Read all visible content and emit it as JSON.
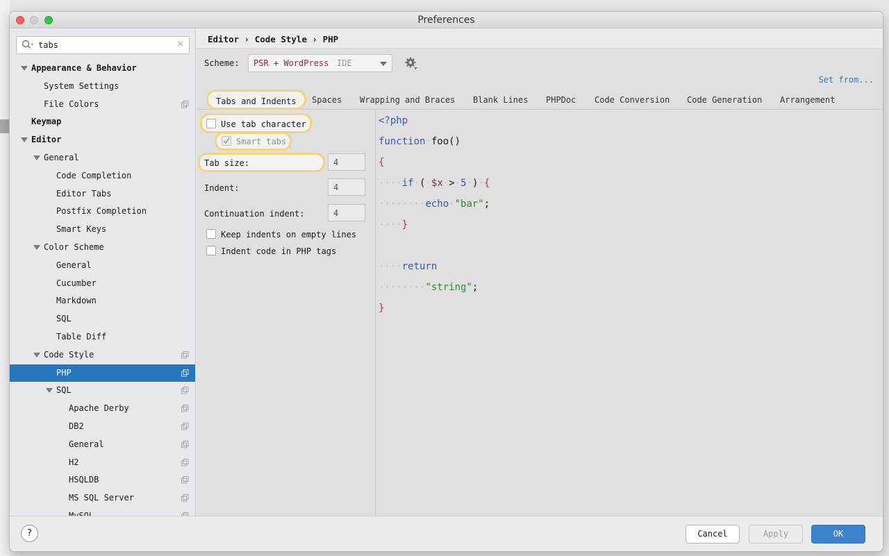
{
  "window": {
    "title": "Preferences"
  },
  "search": {
    "query": "tabs",
    "clear_icon": "×"
  },
  "tree": [
    {
      "label": "Appearance & Behavior",
      "level": 0,
      "bold": true,
      "expanded": true,
      "copy": false,
      "selected": false
    },
    {
      "label": "System Settings",
      "level": 1,
      "bold": false,
      "expanded": false,
      "copy": false,
      "selected": false
    },
    {
      "label": "File Colors",
      "level": 1,
      "bold": false,
      "expanded": false,
      "copy": true,
      "selected": false
    },
    {
      "label": "Keymap",
      "level": 0,
      "bold": true,
      "expanded": false,
      "copy": false,
      "selected": false
    },
    {
      "label": "Editor",
      "level": 0,
      "bold": true,
      "expanded": true,
      "copy": false,
      "selected": false
    },
    {
      "label": "General",
      "level": 1,
      "bold": false,
      "expanded": true,
      "copy": false,
      "selected": false
    },
    {
      "label": "Code Completion",
      "level": 2,
      "bold": false,
      "expanded": false,
      "copy": false,
      "selected": false
    },
    {
      "label": "Editor Tabs",
      "level": 2,
      "bold": false,
      "expanded": false,
      "copy": false,
      "selected": false
    },
    {
      "label": "Postfix Completion",
      "level": 2,
      "bold": false,
      "expanded": false,
      "copy": false,
      "selected": false
    },
    {
      "label": "Smart Keys",
      "level": 2,
      "bold": false,
      "expanded": false,
      "copy": false,
      "selected": false
    },
    {
      "label": "Color Scheme",
      "level": 1,
      "bold": false,
      "expanded": true,
      "copy": false,
      "selected": false
    },
    {
      "label": "General",
      "level": 2,
      "bold": false,
      "expanded": false,
      "copy": false,
      "selected": false
    },
    {
      "label": "Cucumber",
      "level": 2,
      "bold": false,
      "expanded": false,
      "copy": false,
      "selected": false
    },
    {
      "label": "Markdown",
      "level": 2,
      "bold": false,
      "expanded": false,
      "copy": false,
      "selected": false
    },
    {
      "label": "SQL",
      "level": 2,
      "bold": false,
      "expanded": false,
      "copy": false,
      "selected": false
    },
    {
      "label": "Table Diff",
      "level": 2,
      "bold": false,
      "expanded": false,
      "copy": false,
      "selected": false
    },
    {
      "label": "Code Style",
      "level": 1,
      "bold": false,
      "expanded": true,
      "copy": true,
      "selected": false
    },
    {
      "label": "PHP",
      "level": 2,
      "bold": false,
      "expanded": false,
      "copy": true,
      "selected": true
    },
    {
      "label": "SQL",
      "level": 2,
      "bold": false,
      "expanded": true,
      "copy": true,
      "selected": false
    },
    {
      "label": "Apache Derby",
      "level": 3,
      "bold": false,
      "expanded": false,
      "copy": true,
      "selected": false
    },
    {
      "label": "DB2",
      "level": 3,
      "bold": false,
      "expanded": false,
      "copy": true,
      "selected": false
    },
    {
      "label": "General",
      "level": 3,
      "bold": false,
      "expanded": false,
      "copy": true,
      "selected": false
    },
    {
      "label": "H2",
      "level": 3,
      "bold": false,
      "expanded": false,
      "copy": true,
      "selected": false
    },
    {
      "label": "HSQLDB",
      "level": 3,
      "bold": false,
      "expanded": false,
      "copy": true,
      "selected": false
    },
    {
      "label": "MS SQL Server",
      "level": 3,
      "bold": false,
      "expanded": false,
      "copy": true,
      "selected": false
    },
    {
      "label": "MySQL",
      "level": 3,
      "bold": false,
      "expanded": false,
      "copy": true,
      "selected": false
    }
  ],
  "breadcrumb": "Editor › Code Style › PHP",
  "scheme": {
    "label": "Scheme:",
    "value": "PSR + WordPress",
    "tag": "IDE",
    "set_from": "Set from..."
  },
  "tabs": [
    "Tabs and Indents",
    "Spaces",
    "Wrapping and Braces",
    "Blank Lines",
    "PHPDoc",
    "Code Conversion",
    "Code Generation",
    "Arrangement"
  ],
  "active_tab": "Tabs and Indents",
  "options": {
    "use_tab": {
      "label": "Use tab character",
      "checked": false
    },
    "smart_tabs": {
      "label": "Smart tabs",
      "checked": true,
      "enabled": false
    },
    "tab_size": {
      "label": "Tab size:",
      "value": "4"
    },
    "indent": {
      "label": "Indent:",
      "value": "4"
    },
    "continuation": {
      "label": "Continuation indent:",
      "value": "4"
    },
    "keep_indents": {
      "label": "Keep indents on empty lines",
      "checked": false
    },
    "indent_php_tags": {
      "label": "Indent code in PHP tags",
      "checked": false
    }
  },
  "code": {
    "line1": "<?php",
    "line2a": "function",
    "line2b": "foo()",
    "line3": "{",
    "line4a": "if",
    "line4b": "(",
    "line4c": "$x",
    "line4d": ">",
    "line4e": "5",
    "line4f": ")",
    "line4g": "{",
    "line5a": "echo",
    "line5b": "\"bar\"",
    "line5c": ";",
    "line6": "}",
    "line7": "return",
    "line8a": "\"string\"",
    "line8b": ";",
    "line9": "}"
  },
  "buttons": {
    "cancel": "Cancel",
    "apply": "Apply",
    "ok": "OK",
    "help": "?"
  },
  "colors": {
    "accent": "#2675bf",
    "highlight": "#f2d57c",
    "ok": "#3d82cc"
  }
}
